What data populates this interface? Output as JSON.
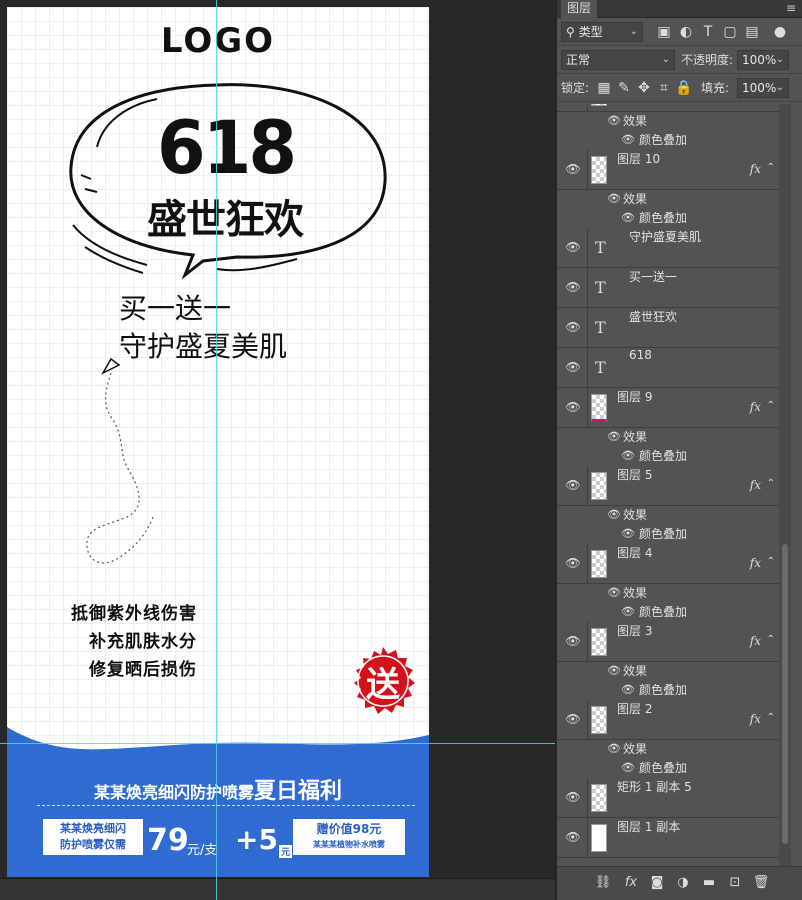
{
  "canvas": {
    "logo": "LOGO",
    "bubble_number": "618",
    "bubble_title": "盛世狂欢",
    "promo_line1": "买一送一",
    "promo_line2": "守护盛夏美肌",
    "features": [
      "抵御紫外线伤害",
      "补充肌肤水分",
      "修复晒后损伤"
    ],
    "badge": "送",
    "banner": {
      "title_small": "某某焕亮细闪防护喷雾",
      "title_big": "夏日福利",
      "left_box_line1": "某某焕亮细闪",
      "left_box_line2": "防护喷雾仅需",
      "price": "79",
      "price_unit": "元/支",
      "plus": "+5",
      "plus_unit": "元",
      "right_box_line1": "赠价值98元",
      "right_box_line2": "某某某植物补水喷雾"
    },
    "colors": {
      "blue": "#2f6bd1",
      "red": "#d4111a"
    }
  },
  "panel": {
    "tab": "图层",
    "filter_label": "类型",
    "blend_mode": "正常",
    "opacity_label": "不透明度:",
    "opacity_value": "100%",
    "lock_label": "锁定:",
    "fill_label": "填充:",
    "fill_value": "100%",
    "layers": [
      {
        "type": "partial",
        "effects": true,
        "effect_label": "效果",
        "effect_item": "颜色叠加"
      },
      {
        "type": "pixel",
        "name": "图层 10",
        "fx": true,
        "effect_label": "效果",
        "effect_item": "颜色叠加"
      },
      {
        "type": "text",
        "name": "守护盛夏美肌"
      },
      {
        "type": "text",
        "name": "买一送一"
      },
      {
        "type": "text",
        "name": "盛世狂欢"
      },
      {
        "type": "text",
        "name": "618"
      },
      {
        "type": "pixel",
        "name": "图层 9",
        "fx": true,
        "effect_label": "效果",
        "effect_item": "颜色叠加"
      },
      {
        "type": "pixel",
        "name": "图层 5",
        "fx": true,
        "effect_label": "效果",
        "effect_item": "颜色叠加"
      },
      {
        "type": "pixel",
        "name": "图层 4",
        "fx": true,
        "effect_label": "效果",
        "effect_item": "颜色叠加"
      },
      {
        "type": "pixel",
        "name": "图层 3",
        "fx": true,
        "effect_label": "效果",
        "effect_item": "颜色叠加"
      },
      {
        "type": "pixel",
        "name": "图层 2",
        "fx": true,
        "effect_label": "效果",
        "effect_item": "颜色叠加"
      },
      {
        "type": "pixel",
        "name": "矩形 1 副本 5"
      },
      {
        "type": "white",
        "name": "图层 1 副本"
      }
    ],
    "text_glyph": "T",
    "fx_label": "fx",
    "footer_icons": [
      "link-icon",
      "fx-icon",
      "mask-icon",
      "adjustment-icon",
      "folder-icon",
      "new-layer-icon",
      "trash-icon"
    ]
  }
}
